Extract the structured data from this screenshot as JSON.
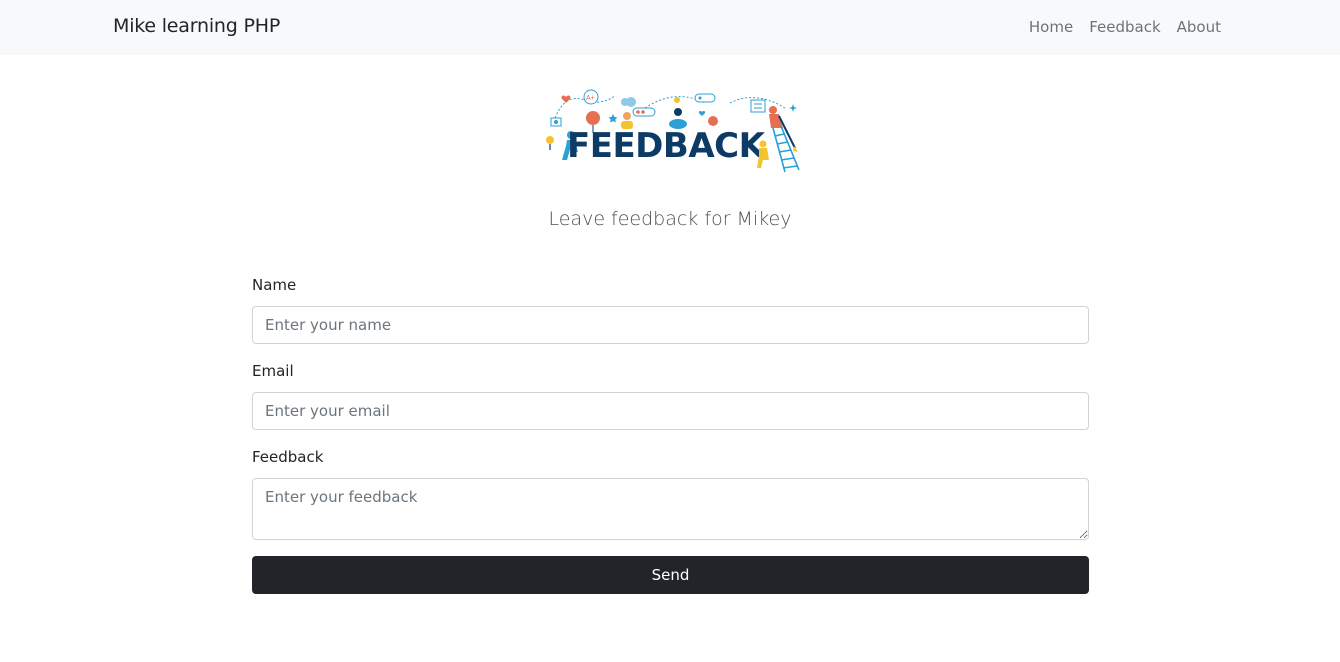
{
  "navbar": {
    "brand": "Mike learning PHP",
    "links": [
      {
        "label": "Home"
      },
      {
        "label": "Feedback"
      },
      {
        "label": "About"
      }
    ]
  },
  "logo": {
    "text": "FEEDBACK",
    "badge_text": "A+",
    "colors": {
      "text": "#0d3b66",
      "accent_blue": "#2a9fd8",
      "accent_orange": "#f4a261",
      "accent_red": "#e76f51",
      "accent_yellow": "#f4c430"
    }
  },
  "subtitle": "Leave feedback for Mikey",
  "form": {
    "name": {
      "label": "Name",
      "placeholder": "Enter your name",
      "value": ""
    },
    "email": {
      "label": "Email",
      "placeholder": "Enter your email",
      "value": ""
    },
    "feedback": {
      "label": "Feedback",
      "placeholder": "Enter your feedback",
      "value": ""
    },
    "submit_label": "Send"
  },
  "colors": {
    "navbar_bg": "#f8f9fa",
    "button_bg": "#212529",
    "input_border": "#ced4da"
  }
}
